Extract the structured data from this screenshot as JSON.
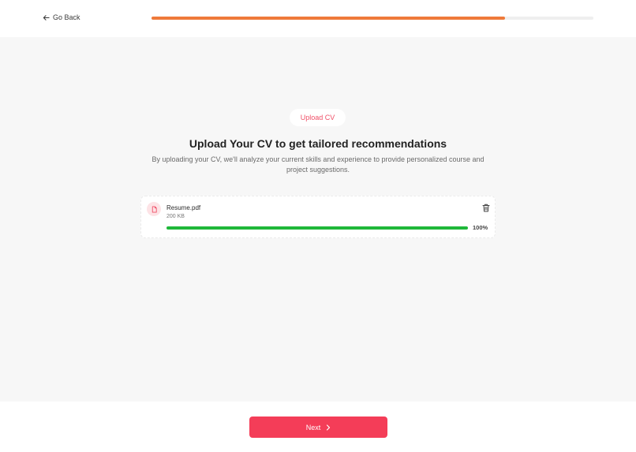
{
  "header": {
    "back_label": "Go Back",
    "back_icon": "arrow-left-icon",
    "progress_fraction": 0.8
  },
  "main": {
    "step_pill": "Upload CV",
    "title": "Upload Your CV to get tailored recommendations",
    "subtitle": "By uploading your CV, we'll analyze your current skills and experience to provide personalized course and project suggestions."
  },
  "file": {
    "icon": "document-icon",
    "name": "Resume.pdf",
    "size": "200 KB",
    "progress_percent": 100,
    "progress_label": "100%",
    "delete_icon": "trash-icon"
  },
  "footer": {
    "next_label": "Next",
    "next_icon": "chevron-right-icon"
  },
  "colors": {
    "accent": "#f43d58",
    "progress_orange": "#ef7a3a",
    "upload_green": "#1fb83a"
  }
}
